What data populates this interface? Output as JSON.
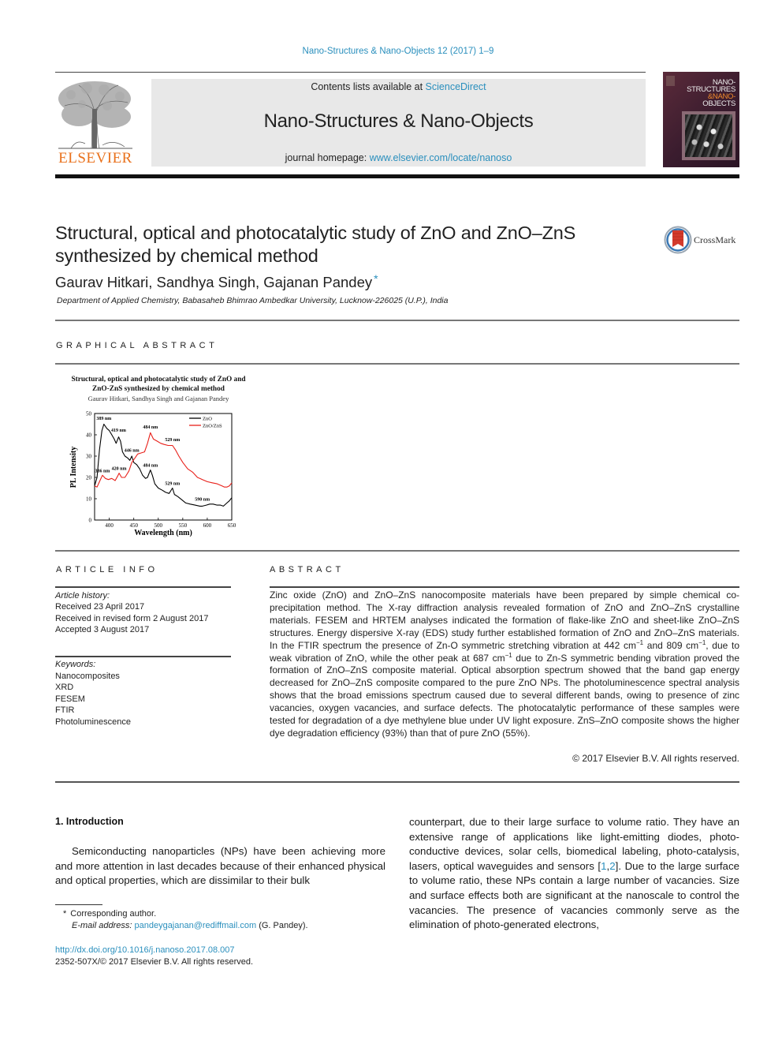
{
  "header": {
    "journal_ref": "Nano-Structures & Nano-Objects 12 (2017) 1–9",
    "contents_prefix": "Contents lists available at ",
    "contents_link": "ScienceDirect",
    "journal_name": "Nano-Structures & Nano-Objects",
    "homepage_prefix": "journal homepage: ",
    "homepage_link": "www.elsevier.com/locate/nanoso",
    "publisher_wordmark": "ELSEVIER",
    "cover_title_lines": [
      "NANO-",
      "STRUCTURES",
      "&NANO-",
      "OBJECTS"
    ],
    "brand_color": "#e9711c",
    "link_color": "#2a8fbd"
  },
  "article": {
    "title_line1": "Structural, optical and photocatalytic study of ZnO and ZnO–ZnS",
    "title_line2": "synthesized by chemical method",
    "authors": "Gaurav Hitkari, Sandhya Singh, Gajanan Pandey",
    "corresponding_marker": "*",
    "affiliation": "Department of Applied Chemistry, Babasaheb Bhimrao Ambedkar University, Lucknow-226025 (U.P.), India",
    "crossmark_label": "CrossMark"
  },
  "sections": {
    "graphical_abstract": "GRAPHICAL ABSTRACT",
    "article_info": "ARTICLE INFO",
    "abstract": "ABSTRACT"
  },
  "graphical_abstract": {
    "title_line1": "Structural, optical and photocatalytic study of ZnO and",
    "title_line2": "ZnO-ZnS synthesized by chemical method",
    "authors": "Gaurav Hitkari, Sandhya Singh and Gajanan Pandey"
  },
  "chart_data": {
    "type": "line",
    "title": "",
    "xlabel": "Wavelength (nm)",
    "ylabel": "PL Intensity",
    "xlim": [
      370,
      650
    ],
    "ylim": [
      0,
      50
    ],
    "xticks": [
      400,
      450,
      500,
      550,
      600,
      650
    ],
    "yticks": [
      0,
      10,
      20,
      30,
      40,
      50
    ],
    "legend_position": "top-right",
    "series": [
      {
        "name": "ZnO",
        "color": "#000000",
        "x": [
          370,
          375,
          380,
          385,
          389,
          395,
          400,
          405,
          410,
          414,
          419,
          423,
          427,
          432,
          438,
          442,
          446,
          450,
          456,
          462,
          468,
          474,
          478,
          484,
          488,
          493,
          500,
          508,
          515,
          522,
          529,
          533,
          540,
          548,
          556,
          565,
          575,
          585,
          590,
          598,
          605,
          612,
          620,
          627,
          633,
          640,
          645,
          650
        ],
        "y": [
          16,
          20,
          33,
          42,
          45,
          43,
          42,
          40,
          38,
          36,
          39,
          37,
          32,
          30,
          29,
          28,
          30,
          27,
          26,
          24,
          21,
          19.5,
          20,
          23.5,
          21,
          17,
          15,
          14,
          13,
          12.5,
          15,
          12,
          11,
          9.5,
          8,
          7.5,
          7,
          6.5,
          6.5,
          7,
          7.5,
          7.5,
          7,
          7,
          6.5,
          8,
          9,
          10.5
        ]
      },
      {
        "name": "ZnO/ZnS",
        "color": "#e8201a",
        "x": [
          370,
          375,
          380,
          386,
          392,
          398,
          405,
          412,
          418,
          420,
          425,
          432,
          440,
          446,
          452,
          458,
          465,
          472,
          478,
          484,
          490,
          498,
          505,
          512,
          520,
          529,
          535,
          542,
          550,
          560,
          570,
          580,
          590,
          600,
          610,
          620,
          630,
          635,
          640,
          645,
          650
        ],
        "y": [
          16,
          15.5,
          18,
          21,
          19.5,
          19,
          19.5,
          18.5,
          21,
          22,
          20,
          20,
          23,
          27,
          29,
          31,
          31.5,
          32,
          36,
          41,
          38,
          37,
          36,
          35.5,
          35,
          35,
          33,
          30,
          27,
          24,
          22.5,
          20,
          19,
          18,
          17.5,
          17,
          16,
          15.5,
          15.5,
          16,
          17.5
        ]
      }
    ],
    "annotations": [
      {
        "text": "389 nm",
        "x": 389,
        "y": 47
      },
      {
        "text": "419 nm",
        "x": 419,
        "y": 41.5
      },
      {
        "text": "446 nm",
        "x": 446,
        "y": 32
      },
      {
        "text": "484 nm",
        "x": 484,
        "y": 25
      },
      {
        "text": "529 nm",
        "x": 529,
        "y": 16.5
      },
      {
        "text": "590 nm",
        "x": 590,
        "y": 9
      },
      {
        "text": "386 nm",
        "x": 386,
        "y": 22.5
      },
      {
        "text": "420 nm",
        "x": 420,
        "y": 23.5
      },
      {
        "text": "484 nm",
        "x": 484,
        "y": 43
      },
      {
        "text": "529 nm",
        "x": 529,
        "y": 37
      }
    ]
  },
  "article_info": {
    "history_label": "Article history:",
    "history": [
      "Received 23 April 2017",
      "Received in revised form 2 August 2017",
      "Accepted 3 August 2017"
    ],
    "keywords_label": "Keywords:",
    "keywords": [
      "Nanocomposites",
      "XRD",
      "FESEM",
      "FTIR",
      "Photoluminescence"
    ]
  },
  "abstract": {
    "part1": "Zinc oxide (ZnO) and ZnO–ZnS nanocomposite materials have been prepared by simple chemical co-precipitation method. The X-ray diffraction analysis revealed formation of ZnO and ZnO–ZnS crystalline materials. FESEM and HRTEM analyses indicated the formation of flake-like ZnO and sheet-like ZnO–ZnS structures. Energy dispersive X-ray (EDS) study further established formation of ZnO and ZnO–ZnS materials. In the FTIR spectrum the presence of Zn-O symmetric stretching vibration at 442 cm",
    "sup": "−1",
    "part2": " and 809 cm",
    "part3": ", due to weak vibration of ZnO, while the other peak at 687 cm",
    "part4": " due to Zn-S symmetric bending vibration proved the formation of ZnO–ZnS composite material. Optical absorption spectrum showed that the band gap energy decreased for ZnO–ZnS composite compared to the pure ZnO NPs. The photoluminescence spectral analysis shows that the broad emissions spectrum caused due to several different bands, owing to presence of zinc vacancies, oxygen vacancies, and surface defects. The photocatalytic performance of these samples were tested for degradation of a dye methylene blue under UV light exposure. ZnS–ZnO composite shows the higher dye degradation efficiency (93%) than that of pure ZnO (55%).",
    "copyright": "© 2017 Elsevier B.V. All rights reserved."
  },
  "introduction": {
    "heading": "1.  Introduction",
    "left_text": "Semiconducting nanoparticles (NPs) have been achieving more and more attention in last decades because of their enhanced physical and optical properties, which are dissimilar to their bulk",
    "right_text_before_ref": "counterpart, due to their large surface to volume ratio. They have an extensive range of applications like light-emitting diodes, photo-conductive devices, solar cells, biomedical labeling, photo-catalysis, lasers, optical waveguides and sensors [",
    "ref1": "1",
    "ref2": "2",
    "right_text_after_ref": "]. Due to the large surface to volume ratio, these NPs contain a large number of vacancies. Size and surface effects both are significant at the nanoscale to control the vacancies. The presence of vacancies commonly serve as the elimination of photo-generated electrons,"
  },
  "footnote": {
    "marker": "*",
    "corresponding": "Corresponding author.",
    "email_label": "E-mail address:",
    "email": "pandeygajanan@rediffmail.com",
    "email_suffix": " (G. Pandey)."
  },
  "footer": {
    "doi": "http://dx.doi.org/10.1016/j.nanoso.2017.08.007",
    "issn_copyright": "2352-507X/© 2017 Elsevier B.V. All rights reserved."
  }
}
